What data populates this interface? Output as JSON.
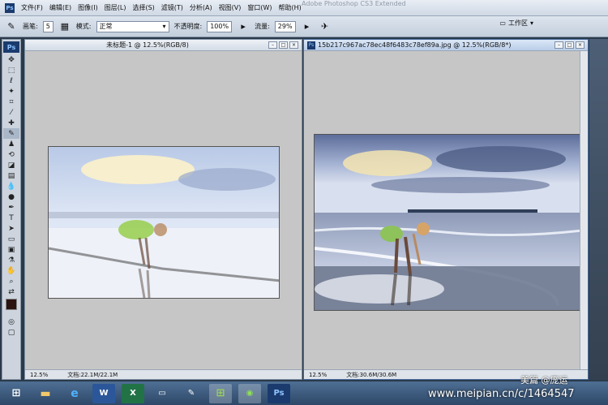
{
  "app": {
    "title": "Adobe Photoshop CS3 Extended",
    "logo": "Ps"
  },
  "menu": [
    "文件(F)",
    "编辑(E)",
    "图像(I)",
    "图层(L)",
    "选择(S)",
    "滤镜(T)",
    "分析(A)",
    "视图(V)",
    "窗口(W)",
    "帮助(H)"
  ],
  "options": {
    "brush_label": "画笔:",
    "brush_size": "5",
    "mode_label": "模式:",
    "mode_value": "正常",
    "opacity_label": "不透明度:",
    "opacity_value": "100%",
    "flow_label": "流量:",
    "flow_value": "29%",
    "workspace_label": "工作区"
  },
  "documents": [
    {
      "title": "未标题-1 @ 12.5%(RGB/8)",
      "zoom": "12.5%",
      "doc_size": "文档:22.1M/22.1M"
    },
    {
      "title": "15b217c967ac78ec48f6483c78ef89a.jpg @ 12.5%(RGB/8*)",
      "zoom": "12.5%",
      "doc_size": "文档:30.6M/30.6M"
    }
  ],
  "taskbar": {
    "items": [
      "start",
      "explorer",
      "ie",
      "word",
      "excel",
      "tablet",
      "pen",
      "windows",
      "wechat",
      "photoshop"
    ],
    "ps_label": "Ps",
    "word_label": "W",
    "excel_label": "X"
  },
  "watermark": {
    "brand": "美篇 @庞运",
    "url": "www.meipian.cn/c/1464547"
  },
  "colors": {
    "foreground": "#2b1410",
    "accent": "#1b3b6e"
  }
}
